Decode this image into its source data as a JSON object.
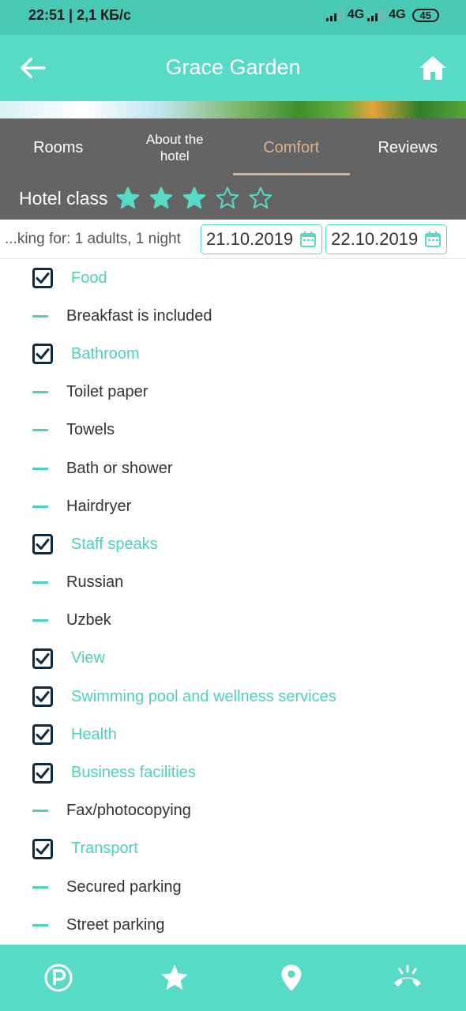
{
  "status_bar": {
    "time": "22:51 | 2,1 КБ/с",
    "network_1": "4G",
    "network_2": "4G",
    "battery": "45"
  },
  "app_bar": {
    "title": "Grace Garden",
    "back_icon": "arrow-left-icon",
    "home_icon": "home-icon"
  },
  "tabs": [
    {
      "label": "Rooms"
    },
    {
      "label": "About the\nhotel"
    },
    {
      "label": "Comfort"
    },
    {
      "label": "Reviews"
    }
  ],
  "hotel_class": {
    "label": "Hotel class",
    "stars_filled": 3,
    "stars_total": 5
  },
  "booking": {
    "text": "...king for: 1 adults, 1 night",
    "check_in": "21.10.2019",
    "check_out": "22.10.2019"
  },
  "amenities": [
    {
      "type": "category",
      "label": "Food"
    },
    {
      "type": "feature",
      "label": "Breakfast is included"
    },
    {
      "type": "category",
      "label": "Bathroom"
    },
    {
      "type": "feature",
      "label": "Toilet paper"
    },
    {
      "type": "feature",
      "label": "Towels"
    },
    {
      "type": "feature",
      "label": "Bath or shower"
    },
    {
      "type": "feature",
      "label": "Hairdryer"
    },
    {
      "type": "category",
      "label": "Staff speaks"
    },
    {
      "type": "feature",
      "label": "Russian"
    },
    {
      "type": "feature",
      "label": "Uzbek"
    },
    {
      "type": "category",
      "label": "View"
    },
    {
      "type": "category",
      "label": "Swimming pool and wellness services"
    },
    {
      "type": "category",
      "label": "Health"
    },
    {
      "type": "category",
      "label": "Business facilities"
    },
    {
      "type": "feature",
      "label": "Fax/photocopying"
    },
    {
      "type": "category",
      "label": "Transport"
    },
    {
      "type": "feature",
      "label": "Secured parking"
    },
    {
      "type": "feature",
      "label": "Street parking"
    }
  ],
  "bottom_nav": [
    "parking-icon",
    "star-icon",
    "location-pin-icon",
    "phone-icon"
  ],
  "colors": {
    "accent": "#57dbc6",
    "tab_bg": "#646464",
    "tab_active": "#d8b497",
    "status_bar": "#48c9b4"
  }
}
